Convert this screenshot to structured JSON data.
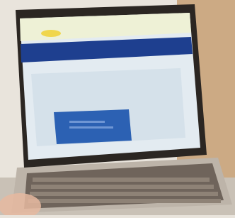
{
  "photo": {
    "subject": "laptop-with-web-page-open",
    "colors": {
      "wall": "#e9e4dc",
      "wood": "#b57a3c",
      "bezel": "#2b2622",
      "screen_bg": "#e3ebf1",
      "nav_bar": "#1e3f8f",
      "accent_yellow": "#f0d64b",
      "login_box": "#2c61b3",
      "keyboard": "#7d7167",
      "aluminium": "#bdb4a9"
    },
    "screen_elements": [
      "top-header-strip",
      "yellow-logo-badge",
      "blue-navigation-bar",
      "light-content-panel",
      "blue-login-dialog"
    ]
  }
}
